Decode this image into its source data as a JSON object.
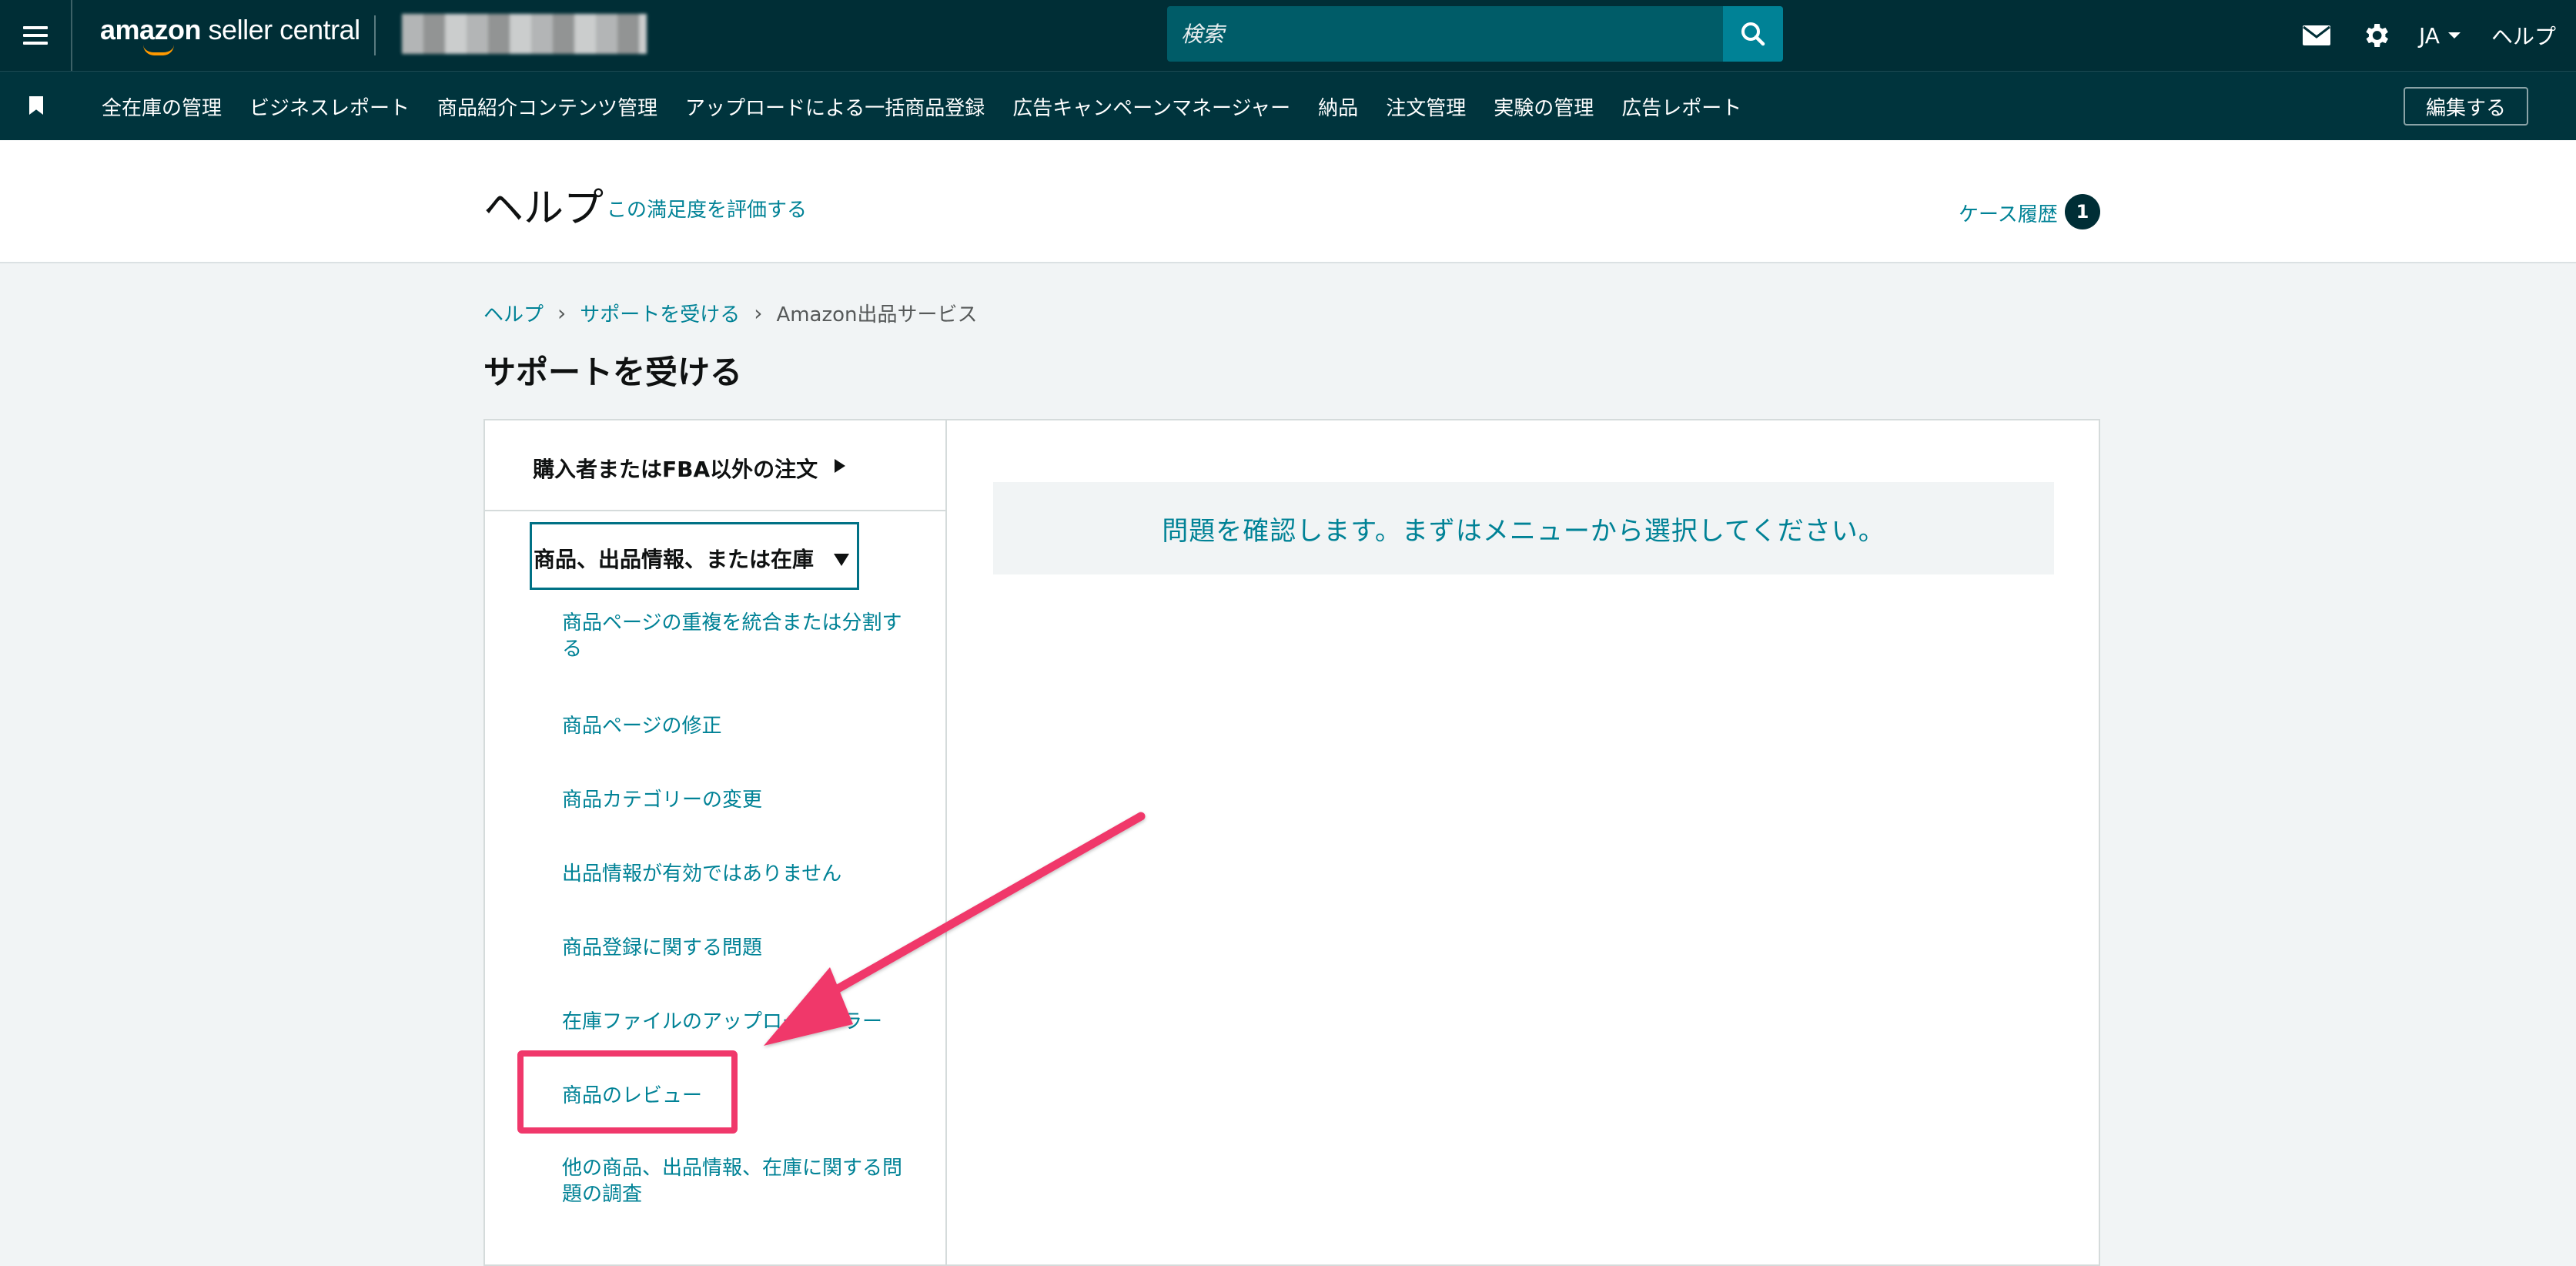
{
  "header": {
    "logo_main": "amazon",
    "logo_sub": " seller central",
    "search_placeholder": "検索",
    "language": "JA",
    "help": "ヘルプ"
  },
  "nav": {
    "items": [
      "全在庫の管理",
      "ビジネスレポート",
      "商品紹介コンテンツ管理",
      "アップロードによる一括商品登録",
      "広告キャンペーンマネージャー",
      "納品",
      "注文管理",
      "実験の管理",
      "広告レポート"
    ],
    "edit_label": "編集する"
  },
  "help_header": {
    "title": "ヘルプ",
    "rate_link": "この満足度を評価する",
    "case_history": "ケース履歴",
    "case_count": "1"
  },
  "breadcrumb": {
    "items": [
      "ヘルプ",
      "サポートを受ける",
      "Amazon出品サービス"
    ]
  },
  "page_title": "サポートを受ける",
  "menu": {
    "category1": "購入者またはFBA以外の注文",
    "category2": "商品、出品情報、または在庫",
    "subitems": [
      "商品ページの重複を統合または分割する",
      "商品ページの修正",
      "商品カテゴリーの変更",
      "出品情報が有効ではありません",
      "商品登録に関する問題",
      "在庫ファイルのアップロードエラー",
      "商品のレビュー",
      "他の商品、出品情報、在庫に関する問題の調査"
    ]
  },
  "notice": "問題を確認します。まずはメニューから選択してください。",
  "colors": {
    "topbar": "#002e36",
    "accent": "#008296",
    "highlight": "#f0386b"
  }
}
